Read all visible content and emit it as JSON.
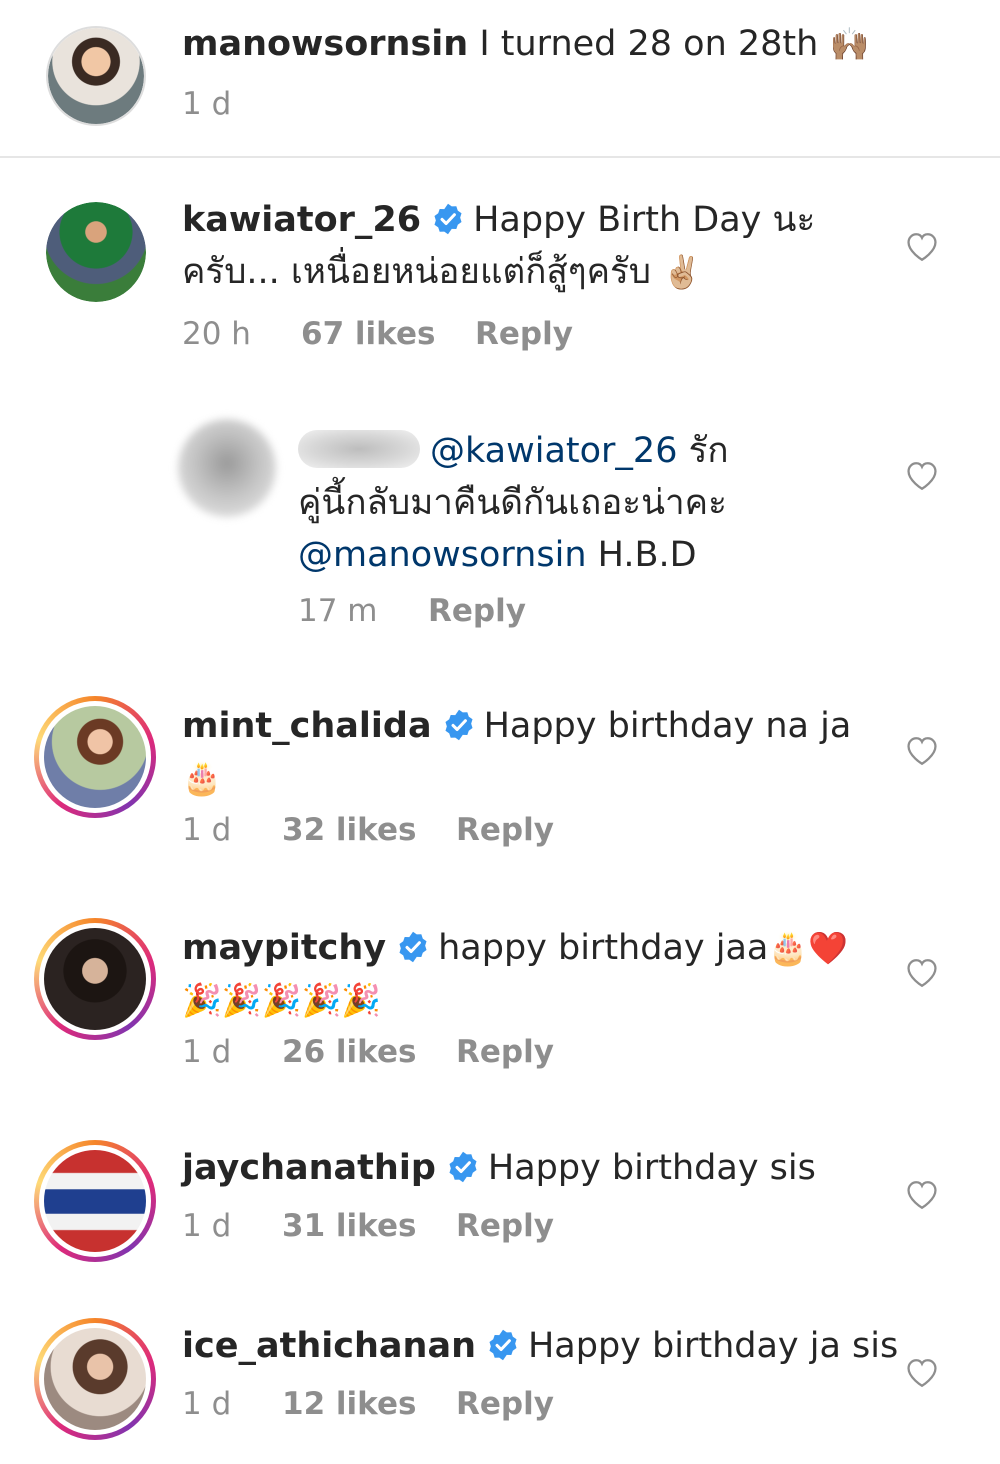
{
  "caption": {
    "username": "manowsornsin",
    "text": "I turned 28 on 28th",
    "emoji": "🙌🏽",
    "time": "1 d"
  },
  "comments": [
    {
      "username": "kawiator_26",
      "verified": true,
      "text_line1": "Happy Birth Day นะ",
      "text_line2": "ครับ... เหนื่อยหน่อยแต่ก็สู้ๆครับ",
      "emoji": "✌🏼",
      "time": "20 h",
      "likes": "67 likes",
      "reply": "Reply"
    },
    {
      "username": "",
      "reply_mention": "@kawiator_26",
      "text_line1_suffix": "รัก",
      "text_line2": "คู่นี้กลับมาคืนดีกันเถอะน่าคะ",
      "mention2": "@manowsornsin",
      "text_line3_suffix": "H.B.D",
      "time": "17 m",
      "reply": "Reply"
    },
    {
      "username": "mint_chalida",
      "verified": true,
      "text": "Happy birthday na ja",
      "emoji": "🎂",
      "time": "1 d",
      "likes": "32 likes",
      "reply": "Reply"
    },
    {
      "username": "maypitchy",
      "verified": true,
      "text": "happy birthday jaa",
      "emoji": "🎂❤️",
      "emoji_line2": "🎉🎉🎉🎉🎉",
      "time": "1 d",
      "likes": "26 likes",
      "reply": "Reply"
    },
    {
      "username": "jaychanathip",
      "verified": true,
      "text": "Happy birthday sis",
      "time": "1 d",
      "likes": "31 likes",
      "reply": "Reply"
    },
    {
      "username": "ice_athichanan",
      "verified": true,
      "text": "Happy birthday ja sis",
      "time": "1 d",
      "likes": "12 likes",
      "reply": "Reply"
    }
  ],
  "colors": {
    "verified": "#3897f0",
    "mention": "#00376b",
    "meta": "#8e8e8e",
    "divider": "#e6e6e6"
  },
  "icons": {
    "like": "heart-outline-icon",
    "verified": "verified-badge-icon"
  }
}
